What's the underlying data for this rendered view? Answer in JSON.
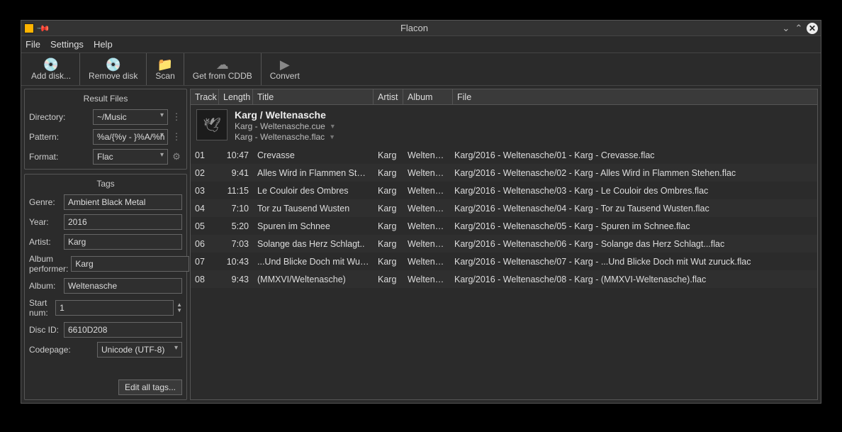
{
  "window": {
    "title": "Flacon"
  },
  "menu": {
    "file": "File",
    "settings": "Settings",
    "help": "Help"
  },
  "toolbar": {
    "add_disk": "Add disk...",
    "remove_disk": "Remove disk",
    "scan": "Scan",
    "cddb": "Get from CDDB",
    "convert": "Convert"
  },
  "result_files": {
    "title": "Result Files",
    "directory_label": "Directory:",
    "directory_value": "~/Music",
    "pattern_label": "Pattern:",
    "pattern_value": "%a/{%y - }%A/%n - %a - %t",
    "format_label": "Format:",
    "format_value": "Flac"
  },
  "tags": {
    "title": "Tags",
    "genre_label": "Genre:",
    "genre_value": "Ambient Black Metal",
    "year_label": "Year:",
    "year_value": "2016",
    "artist_label": "Artist:",
    "artist_value": "Karg",
    "album_performer_label": "Album performer:",
    "album_performer_value": "Karg",
    "album_label": "Album:",
    "album_value": "Weltenasche",
    "start_num_label": "Start num:",
    "start_num_value": "1",
    "disc_id_label": "Disc ID:",
    "disc_id_value": "6610D208",
    "codepage_label": "Codepage:",
    "codepage_value": "Unicode (UTF-8)",
    "edit_all": "Edit all tags..."
  },
  "table": {
    "headers": {
      "track": "Track",
      "length": "Length",
      "title": "Title",
      "artist": "Artist",
      "album": "Album",
      "file": "File"
    }
  },
  "album_header": {
    "title": "Karg / Weltenasche",
    "cue": "Karg - Weltenasche.cue",
    "flac": "Karg - Weltenasche.flac"
  },
  "tracks": [
    {
      "num": "01",
      "len": "10:47",
      "title": "Crevasse",
      "artist": "Karg",
      "album": "Weltenasche",
      "file": "Karg/2016 - Weltenasche/01 - Karg - Crevasse.flac"
    },
    {
      "num": "02",
      "len": "9:41",
      "title": "Alles Wird in Flammen Stehen",
      "artist": "Karg",
      "album": "Weltenasche",
      "file": "Karg/2016 - Weltenasche/02 - Karg - Alles Wird in Flammen Stehen.flac"
    },
    {
      "num": "03",
      "len": "11:15",
      "title": "Le Couloir des Ombres",
      "artist": "Karg",
      "album": "Weltenasche",
      "file": "Karg/2016 - Weltenasche/03 - Karg - Le Couloir des Ombres.flac"
    },
    {
      "num": "04",
      "len": "7:10",
      "title": "Tor zu Tausend Wusten",
      "artist": "Karg",
      "album": "Weltenasche",
      "file": "Karg/2016 - Weltenasche/04 - Karg - Tor zu Tausend Wusten.flac"
    },
    {
      "num": "05",
      "len": "5:20",
      "title": "Spuren im Schnee",
      "artist": "Karg",
      "album": "Weltenasche",
      "file": "Karg/2016 - Weltenasche/05 - Karg - Spuren im Schnee.flac"
    },
    {
      "num": "06",
      "len": "7:03",
      "title": "Solange das Herz Schlagt..",
      "artist": "Karg",
      "album": "Weltenasche",
      "file": "Karg/2016 - Weltenasche/06 - Karg - Solange das Herz Schlagt...flac"
    },
    {
      "num": "07",
      "len": "10:43",
      "title": "...Und Blicke Doch mit Wut zuruck",
      "artist": "Karg",
      "album": "Weltenasche",
      "file": "Karg/2016 - Weltenasche/07 - Karg - ...Und Blicke Doch mit Wut zuruck.flac"
    },
    {
      "num": "08",
      "len": "9:43",
      "title": "(MMXVI/Weltenasche)",
      "artist": "Karg",
      "album": "Weltenasche",
      "file": "Karg/2016 - Weltenasche/08 - Karg - (MMXVI-Weltenasche).flac"
    }
  ]
}
